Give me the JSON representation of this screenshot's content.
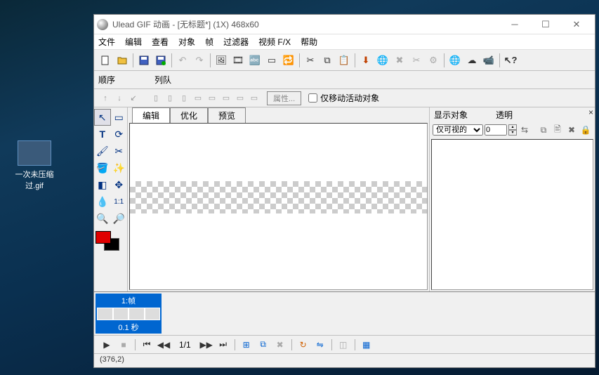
{
  "desktop": {
    "file_label": "一次未压缩过.gif"
  },
  "title": "Ulead GIF 动画 - [无标题*] (1X) 468x60",
  "menu": {
    "file": "文件",
    "edit": "编辑",
    "view": "查看",
    "object": "对象",
    "frame": "帧",
    "filter": "过滤器",
    "video_fx": "视频 F/X",
    "help": "帮助"
  },
  "secondbar": {
    "order": "顺序",
    "queue": "列队",
    "properties": "属性...",
    "move_only": "仅移动活动对象"
  },
  "tabs": {
    "edit": "编辑",
    "optimize": "优化",
    "preview": "预览"
  },
  "rightpanel": {
    "show_objects": "显示对象",
    "transparent": "透明",
    "visible_only": "仅可视的",
    "transp_val": "0"
  },
  "frame": {
    "label": "1:帧",
    "delay": "0.1 秒"
  },
  "playbar": {
    "position": "1/1"
  },
  "status": "(376,2)"
}
